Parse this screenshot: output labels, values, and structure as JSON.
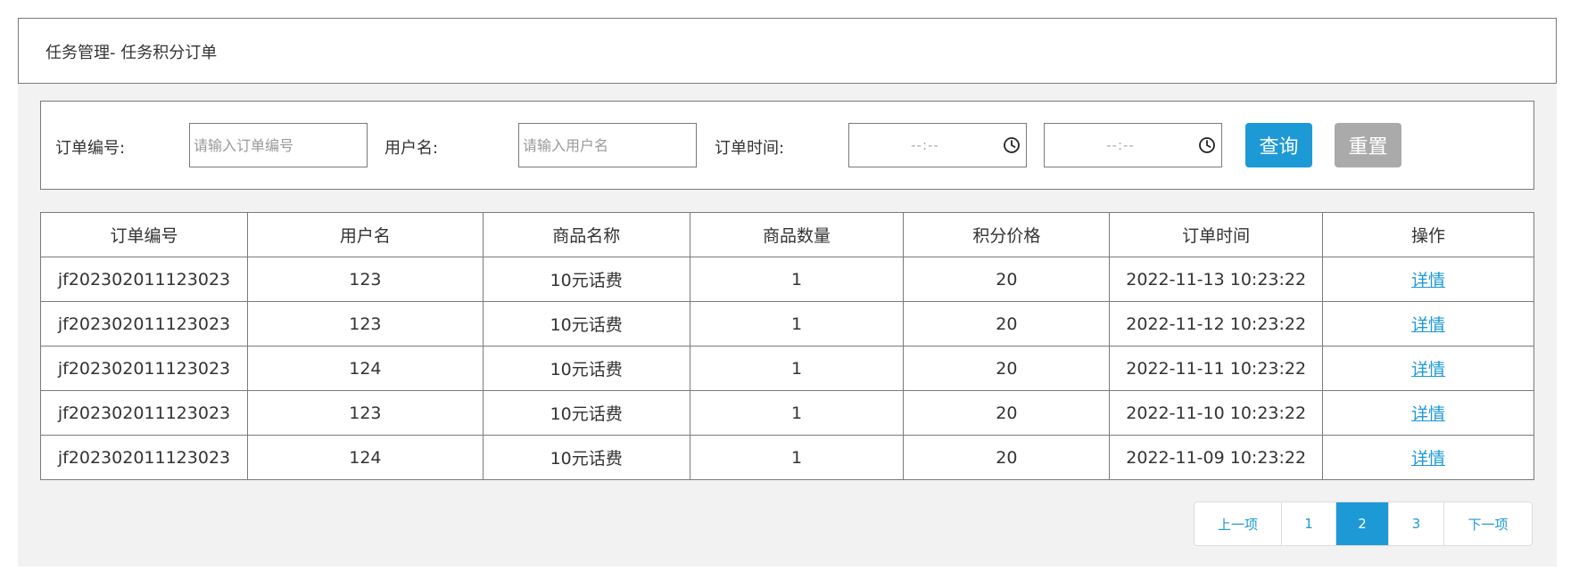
{
  "header": {
    "title": "任务管理- 任务积分订单"
  },
  "filters": {
    "order_no_label": "订单编号:",
    "order_no_placeholder": "请输入订单编号",
    "username_label": "用户名:",
    "username_placeholder": "请输入用户名",
    "order_time_label": "订单时间:",
    "time_start": "--:--",
    "time_end": "--:--",
    "query_label": "查询",
    "reset_label": "重置"
  },
  "table": {
    "headers": [
      "订单编号",
      "用户名",
      "商品名称",
      "商品数量",
      "积分价格",
      "订单时间",
      "操作"
    ],
    "rows": [
      [
        "jf202302011123023",
        "123",
        "10元话费",
        "1",
        "20",
        "2022-11-13 10:23:22",
        "详情"
      ],
      [
        "jf202302011123023",
        "123",
        "10元话费",
        "1",
        "20",
        "2022-11-12 10:23:22",
        "详情"
      ],
      [
        "jf202302011123023",
        "124",
        "10元话费",
        "1",
        "20",
        "2022-11-11 10:23:22",
        "详情"
      ],
      [
        "jf202302011123023",
        "123",
        "10元话费",
        "1",
        "20",
        "2022-11-10 10:23:22",
        "详情"
      ],
      [
        "jf202302011123023",
        "124",
        "10元话费",
        "1",
        "20",
        "2022-11-09 10:23:22",
        "详情"
      ]
    ]
  },
  "pagination": {
    "prev_label": "上一项",
    "pages": [
      "1",
      "2",
      "3"
    ],
    "current_page": "2",
    "next_label": "下一项"
  },
  "colors": {
    "accent": "#1d9ad6",
    "reset_button": "#aaaaaa",
    "content_background": "#f2f2f2",
    "border": "#7a7a7a"
  }
}
